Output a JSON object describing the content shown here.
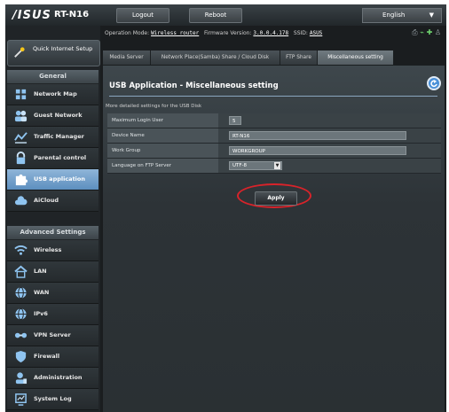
{
  "header": {
    "logo": "/ISUS",
    "model": "RT-N16",
    "logout_label": "Logout",
    "reboot_label": "Reboot",
    "language": "English"
  },
  "sidebar": {
    "quick_setup_label": "Quick Internet Setup",
    "general_label": "General",
    "general_items": [
      {
        "label": "Network Map",
        "icon": "network-map-icon"
      },
      {
        "label": "Guest Network",
        "icon": "guest-network-icon"
      },
      {
        "label": "Traffic Manager",
        "icon": "traffic-manager-icon"
      },
      {
        "label": "Parental control",
        "icon": "lock-icon"
      },
      {
        "label": "USB application",
        "icon": "puzzle-icon"
      },
      {
        "label": "AiCloud",
        "icon": "cloud-icon"
      }
    ],
    "advanced_label": "Advanced Settings",
    "advanced_items": [
      {
        "label": "Wireless",
        "icon": "wifi-icon"
      },
      {
        "label": "LAN",
        "icon": "home-icon"
      },
      {
        "label": "WAN",
        "icon": "globe-icon"
      },
      {
        "label": "IPv6",
        "icon": "globe-icon"
      },
      {
        "label": "VPN Server",
        "icon": "vpn-icon"
      },
      {
        "label": "Firewall",
        "icon": "shield-icon"
      },
      {
        "label": "Administration",
        "icon": "admin-icon"
      },
      {
        "label": "System Log",
        "icon": "system-log-icon"
      }
    ]
  },
  "status": {
    "op_mode_label": "Operation Mode:",
    "op_mode": "Wireless router",
    "fw_label": "Firmware Version:",
    "fw": "3.0.0.4.178",
    "ssid_label": "SSID:",
    "ssid": "ASUS"
  },
  "tabs": [
    "Media Server",
    "Network Place(Samba) Share / Cloud Disk",
    "FTP Share",
    "Miscellaneous setting"
  ],
  "panel": {
    "title": "USB Application - Miscellaneous setting",
    "description": "More detailed settings for the USB Disk",
    "rows": [
      {
        "label": "Maximum Login User",
        "value": "5"
      },
      {
        "label": "Device Name",
        "value": "RT-N16"
      },
      {
        "label": "Work Group",
        "value": "WORKGROUP"
      },
      {
        "label": "Language on FTP Server",
        "value": "UTF-8"
      }
    ],
    "apply_label": "Apply"
  },
  "colors": {
    "accent": "#5d8fbf",
    "highlight": "#d8232a"
  }
}
